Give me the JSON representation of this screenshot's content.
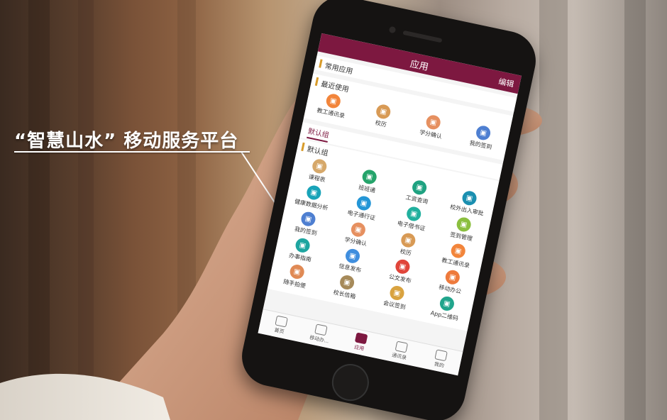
{
  "caption": "“智慧山水” 移动服务平台",
  "app": {
    "title": "应用",
    "edit": "编辑",
    "sections": [
      {
        "title": "常用应用",
        "items": []
      },
      {
        "title": "最近使用",
        "items": [
          {
            "label": "教工通讯录",
            "color": "#f2853b"
          },
          {
            "label": "校历",
            "color": "#d89a55"
          },
          {
            "label": "学分确认",
            "color": "#e69060"
          },
          {
            "label": "我的签到",
            "color": "#4e7fd1"
          }
        ]
      }
    ],
    "tab": "默认组",
    "default_group": {
      "title": "默认组",
      "items": [
        {
          "label": "课程表",
          "color": "#d6a86a"
        },
        {
          "label": "班班通",
          "color": "#25a46b"
        },
        {
          "label": "工资查询",
          "color": "#1fa281"
        },
        {
          "label": "校外出入审批",
          "color": "#1a8fb0"
        },
        {
          "label": "健康数据分析",
          "color": "#18a3b8"
        },
        {
          "label": "电子通行证",
          "color": "#2496d6"
        },
        {
          "label": "电子借书证",
          "color": "#21b09e"
        },
        {
          "label": "签到管理",
          "color": "#8bbf3f"
        },
        {
          "label": "我的签到",
          "color": "#4e7fd1"
        },
        {
          "label": "学分确认",
          "color": "#e69060"
        },
        {
          "label": "校历",
          "color": "#d89a55"
        },
        {
          "label": "教工通讯录",
          "color": "#f2853b"
        },
        {
          "label": "办事指南",
          "color": "#1ea5a0"
        },
        {
          "label": "信息发布",
          "color": "#3f8ede"
        },
        {
          "label": "公文发布",
          "color": "#e0453a"
        },
        {
          "label": "移动办公",
          "color": "#ee7a3c"
        },
        {
          "label": "随手拍便",
          "color": "#e08a55"
        },
        {
          "label": "校长信箱",
          "color": "#a68a5a"
        },
        {
          "label": "会议签到",
          "color": "#d9a340"
        },
        {
          "label": "App二维码",
          "color": "#21a58c"
        }
      ]
    },
    "nav": [
      {
        "label": "首页",
        "active": false
      },
      {
        "label": "移动办...",
        "active": false
      },
      {
        "label": "应用",
        "active": true
      },
      {
        "label": "通讯录",
        "active": false
      },
      {
        "label": "我的",
        "active": false
      }
    ]
  }
}
